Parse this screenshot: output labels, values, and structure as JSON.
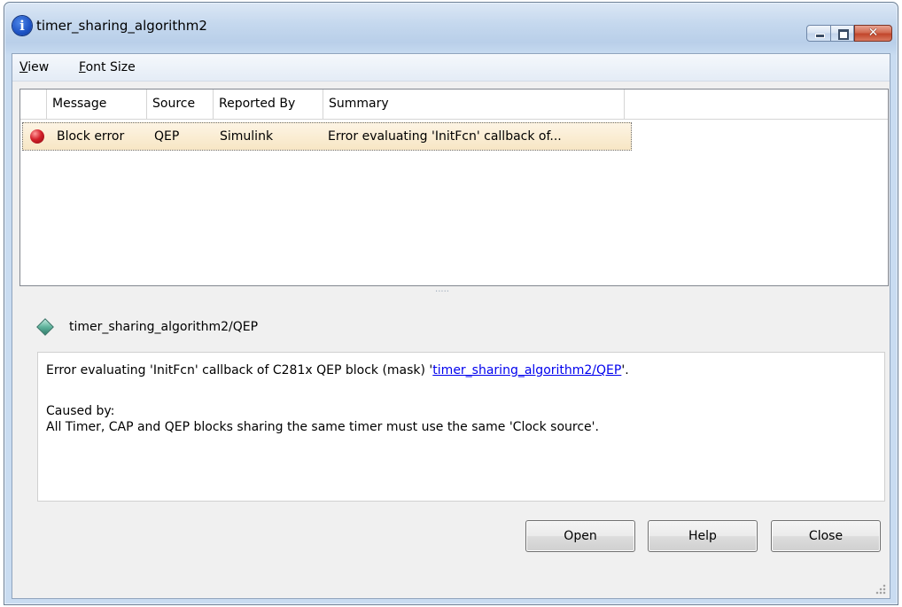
{
  "window": {
    "title": "timer_sharing_algorithm2",
    "icon": "info-icon",
    "caption_buttons": [
      "minimize",
      "maximize",
      "close"
    ]
  },
  "menubar": {
    "items": [
      {
        "label": "View",
        "mnemonic": "V",
        "rest": "iew"
      },
      {
        "label": "Font Size",
        "mnemonic": "F",
        "rest": "ont Size"
      }
    ]
  },
  "table": {
    "columns": [
      "Message",
      "Source",
      "Reported By",
      "Summary"
    ],
    "rows": [
      {
        "icon": "error-icon",
        "message": "Block error",
        "source": "QEP",
        "reported_by": "Simulink",
        "summary": "Error evaluating 'InitFcn' callback of..."
      }
    ]
  },
  "splitter": {
    "grip": "....."
  },
  "detail": {
    "block_path": "timer_sharing_algorithm2/QEP",
    "block_icon": "simulink-block-icon",
    "line1_prefix": "Error evaluating 'InitFcn' callback of C281x QEP block (mask) '",
    "line1_link": "timer_sharing_algorithm2/QEP",
    "line1_suffix": "'.",
    "caused_by_label": "Caused by:",
    "cause": "All Timer, CAP and QEP blocks sharing the same timer must use the same 'Clock source'."
  },
  "buttons": {
    "open": "Open",
    "help": "Help",
    "close": "Close"
  },
  "colors": {
    "error_dot": "#d3202a",
    "link": "#0000ee",
    "selected_row": "#f7e6c4",
    "close_button": "#c2462b"
  }
}
